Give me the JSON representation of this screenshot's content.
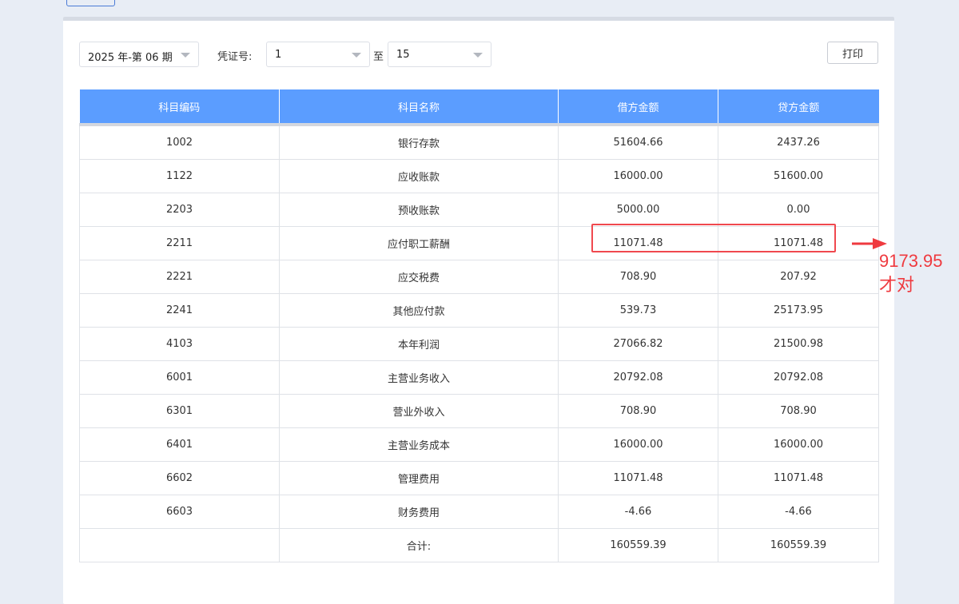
{
  "toolbar": {
    "period_value": "2025 年-第 06 期",
    "voucher_label": "凭证号:",
    "voucher_from": "1",
    "to_label": "至",
    "voucher_to": "15",
    "print_label": "打印"
  },
  "table": {
    "headers": [
      "科目编码",
      "科目名称",
      "借方金额",
      "贷方金额"
    ],
    "rows": [
      [
        "1002",
        "银行存款",
        "51604.66",
        "2437.26"
      ],
      [
        "1122",
        "应收账款",
        "16000.00",
        "51600.00"
      ],
      [
        "2203",
        "预收账款",
        "5000.00",
        "0.00"
      ],
      [
        "2211",
        "应付职工薪酬",
        "11071.48",
        "11071.48"
      ],
      [
        "2221",
        "应交税费",
        "708.90",
        "207.92"
      ],
      [
        "2241",
        "其他应付款",
        "539.73",
        "25173.95"
      ],
      [
        "4103",
        "本年利润",
        "27066.82",
        "21500.98"
      ],
      [
        "6001",
        "主营业务收入",
        "20792.08",
        "20792.08"
      ],
      [
        "6301",
        "营业外收入",
        "708.90",
        "708.90"
      ],
      [
        "6401",
        "主营业务成本",
        "16000.00",
        "16000.00"
      ],
      [
        "6602",
        "管理费用",
        "11071.48",
        "11071.48"
      ],
      [
        "6603",
        "财务费用",
        "-4.66",
        "-4.66"
      ]
    ],
    "total": [
      "",
      "合计:",
      "160559.39",
      "160559.39"
    ]
  },
  "annotation": {
    "text_line1": "9173.95",
    "text_line2": "才对",
    "color": "#ef3a3f"
  },
  "colors": {
    "header_bg": "#5b9dff",
    "page_bg": "#e8edf5"
  }
}
